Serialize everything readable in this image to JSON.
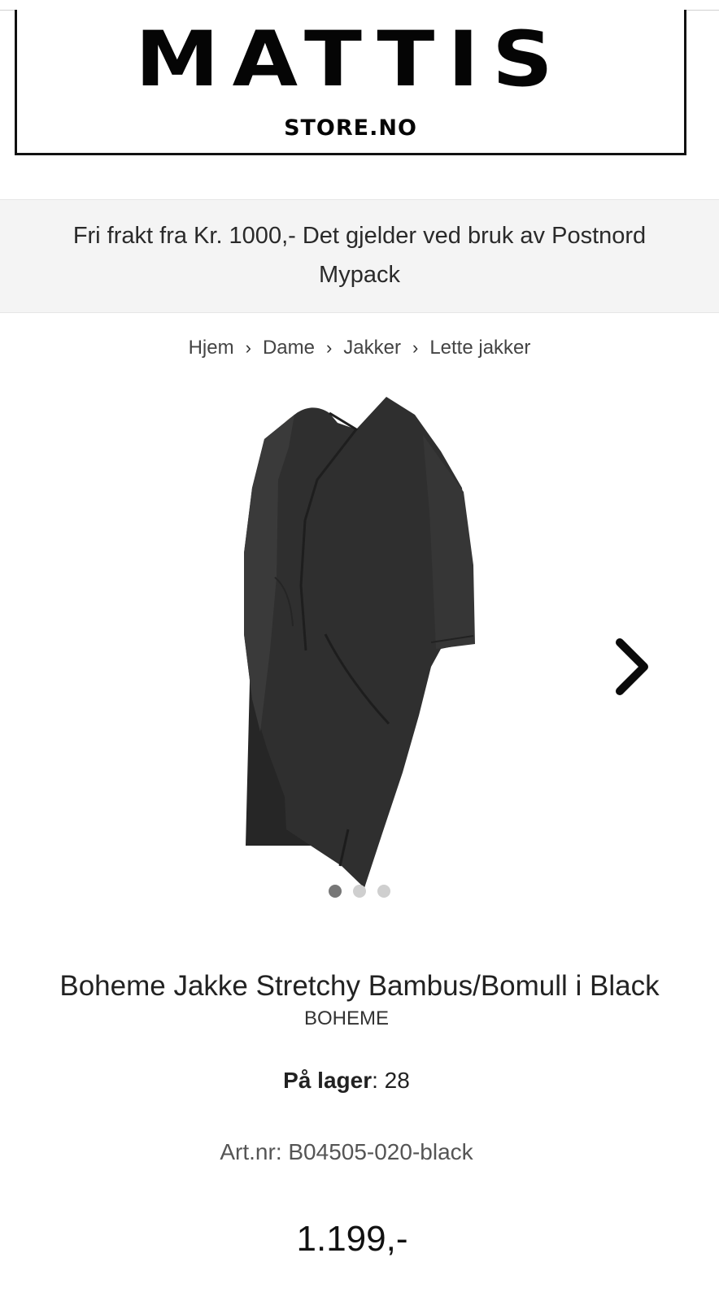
{
  "header": {
    "logo_main": "MATTIS",
    "logo_sub": "STORE.NO"
  },
  "promo": {
    "text": "Fri frakt fra Kr. 1000,- Det gjelder ved bruk av Postnord Mypack"
  },
  "breadcrumb": {
    "items": [
      "Hjem",
      "Dame",
      "Jakker",
      "Lette jakker"
    ],
    "separator": "›"
  },
  "gallery": {
    "image_icon": "product-photo-black-jacket",
    "next_icon": "chevron-right-icon",
    "image_count": 3,
    "active_index": 1
  },
  "product": {
    "title": "Boheme Jakke Stretchy Bambus/Bomull i Black",
    "brand": "BOHEME",
    "stock_label": "På lager",
    "stock_separator": ": ",
    "stock_value": "28",
    "art_nr": "Art.nr: B04505-020-black",
    "price": "1.199,-"
  },
  "colors": {
    "promo_bg": "#f4f4f4",
    "garment": "#2e2e2e",
    "mannequin": "#e4ddd3",
    "dot_active": "#777777",
    "dot_inactive": "#cfcfcf"
  }
}
